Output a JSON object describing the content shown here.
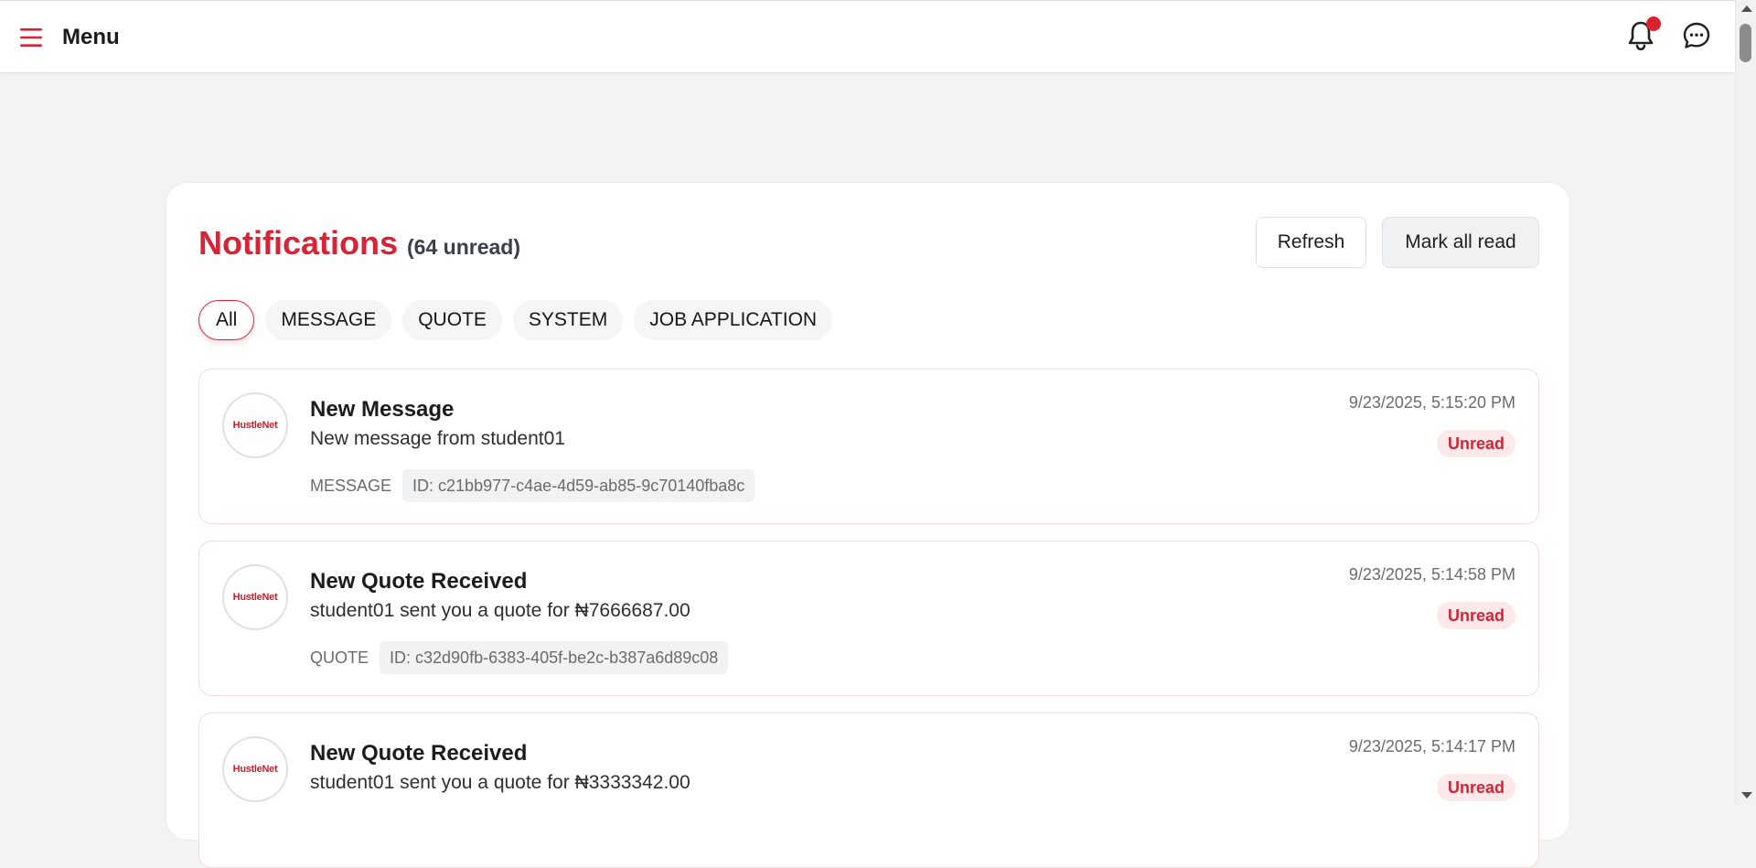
{
  "topbar": {
    "menu_label": "Menu",
    "has_unread_indicator": true
  },
  "colors": {
    "accent": "#d42435",
    "badge_bg": "#fde8ea",
    "page_bg": "#f3f3f3"
  },
  "page": {
    "title": "Notifications",
    "unread_count_text": "(64 unread)",
    "refresh_label": "Refresh",
    "mark_all_label": "Mark all read"
  },
  "filters": [
    {
      "label": "All",
      "active": true
    },
    {
      "label": "MESSAGE",
      "active": false
    },
    {
      "label": "QUOTE",
      "active": false
    },
    {
      "label": "SYSTEM",
      "active": false
    },
    {
      "label": "JOB APPLICATION",
      "active": false
    }
  ],
  "notifications": [
    {
      "avatar_text": "HustleNet",
      "title": "New Message",
      "body": "New message from student01",
      "type": "MESSAGE",
      "id_text": "ID: c21bb977-c4ae-4d59-ab85-9c70140fba8c",
      "time": "9/23/2025, 5:15:20 PM",
      "status": "Unread"
    },
    {
      "avatar_text": "HustleNet",
      "title": "New Quote Received",
      "body": "student01 sent you a quote for ₦7666687.00",
      "type": "QUOTE",
      "id_text": "ID: c32d90fb-6383-405f-be2c-b387a6d89c08",
      "time": "9/23/2025, 5:14:58 PM",
      "status": "Unread"
    },
    {
      "avatar_text": "HustleNet",
      "title": "New Quote Received",
      "body": "student01 sent you a quote for ₦3333342.00",
      "type": "",
      "id_text": "",
      "time": "9/23/2025, 5:14:17 PM",
      "status": "Unread"
    }
  ]
}
